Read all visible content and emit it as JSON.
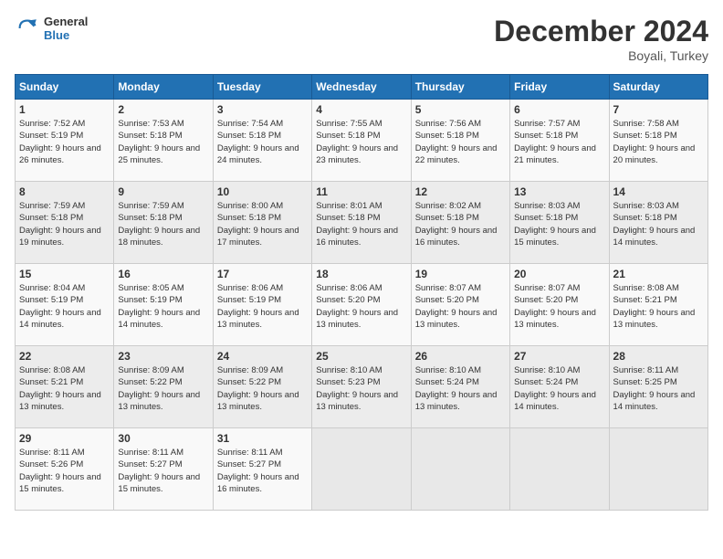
{
  "header": {
    "logo_general": "General",
    "logo_blue": "Blue",
    "title": "December 2024",
    "location": "Boyali, Turkey"
  },
  "days_of_week": [
    "Sunday",
    "Monday",
    "Tuesday",
    "Wednesday",
    "Thursday",
    "Friday",
    "Saturday"
  ],
  "weeks": [
    [
      {
        "day": "1",
        "sunrise": "7:52 AM",
        "sunset": "5:19 PM",
        "daylight": "9 hours and 26 minutes."
      },
      {
        "day": "2",
        "sunrise": "7:53 AM",
        "sunset": "5:18 PM",
        "daylight": "9 hours and 25 minutes."
      },
      {
        "day": "3",
        "sunrise": "7:54 AM",
        "sunset": "5:18 PM",
        "daylight": "9 hours and 24 minutes."
      },
      {
        "day": "4",
        "sunrise": "7:55 AM",
        "sunset": "5:18 PM",
        "daylight": "9 hours and 23 minutes."
      },
      {
        "day": "5",
        "sunrise": "7:56 AM",
        "sunset": "5:18 PM",
        "daylight": "9 hours and 22 minutes."
      },
      {
        "day": "6",
        "sunrise": "7:57 AM",
        "sunset": "5:18 PM",
        "daylight": "9 hours and 21 minutes."
      },
      {
        "day": "7",
        "sunrise": "7:58 AM",
        "sunset": "5:18 PM",
        "daylight": "9 hours and 20 minutes."
      }
    ],
    [
      {
        "day": "8",
        "sunrise": "7:59 AM",
        "sunset": "5:18 PM",
        "daylight": "9 hours and 19 minutes."
      },
      {
        "day": "9",
        "sunrise": "7:59 AM",
        "sunset": "5:18 PM",
        "daylight": "9 hours and 18 minutes."
      },
      {
        "day": "10",
        "sunrise": "8:00 AM",
        "sunset": "5:18 PM",
        "daylight": "9 hours and 17 minutes."
      },
      {
        "day": "11",
        "sunrise": "8:01 AM",
        "sunset": "5:18 PM",
        "daylight": "9 hours and 16 minutes."
      },
      {
        "day": "12",
        "sunrise": "8:02 AM",
        "sunset": "5:18 PM",
        "daylight": "9 hours and 16 minutes."
      },
      {
        "day": "13",
        "sunrise": "8:03 AM",
        "sunset": "5:18 PM",
        "daylight": "9 hours and 15 minutes."
      },
      {
        "day": "14",
        "sunrise": "8:03 AM",
        "sunset": "5:18 PM",
        "daylight": "9 hours and 14 minutes."
      }
    ],
    [
      {
        "day": "15",
        "sunrise": "8:04 AM",
        "sunset": "5:19 PM",
        "daylight": "9 hours and 14 minutes."
      },
      {
        "day": "16",
        "sunrise": "8:05 AM",
        "sunset": "5:19 PM",
        "daylight": "9 hours and 14 minutes."
      },
      {
        "day": "17",
        "sunrise": "8:06 AM",
        "sunset": "5:19 PM",
        "daylight": "9 hours and 13 minutes."
      },
      {
        "day": "18",
        "sunrise": "8:06 AM",
        "sunset": "5:20 PM",
        "daylight": "9 hours and 13 minutes."
      },
      {
        "day": "19",
        "sunrise": "8:07 AM",
        "sunset": "5:20 PM",
        "daylight": "9 hours and 13 minutes."
      },
      {
        "day": "20",
        "sunrise": "8:07 AM",
        "sunset": "5:20 PM",
        "daylight": "9 hours and 13 minutes."
      },
      {
        "day": "21",
        "sunrise": "8:08 AM",
        "sunset": "5:21 PM",
        "daylight": "9 hours and 13 minutes."
      }
    ],
    [
      {
        "day": "22",
        "sunrise": "8:08 AM",
        "sunset": "5:21 PM",
        "daylight": "9 hours and 13 minutes."
      },
      {
        "day": "23",
        "sunrise": "8:09 AM",
        "sunset": "5:22 PM",
        "daylight": "9 hours and 13 minutes."
      },
      {
        "day": "24",
        "sunrise": "8:09 AM",
        "sunset": "5:22 PM",
        "daylight": "9 hours and 13 minutes."
      },
      {
        "day": "25",
        "sunrise": "8:10 AM",
        "sunset": "5:23 PM",
        "daylight": "9 hours and 13 minutes."
      },
      {
        "day": "26",
        "sunrise": "8:10 AM",
        "sunset": "5:24 PM",
        "daylight": "9 hours and 13 minutes."
      },
      {
        "day": "27",
        "sunrise": "8:10 AM",
        "sunset": "5:24 PM",
        "daylight": "9 hours and 14 minutes."
      },
      {
        "day": "28",
        "sunrise": "8:11 AM",
        "sunset": "5:25 PM",
        "daylight": "9 hours and 14 minutes."
      }
    ],
    [
      {
        "day": "29",
        "sunrise": "8:11 AM",
        "sunset": "5:26 PM",
        "daylight": "9 hours and 15 minutes."
      },
      {
        "day": "30",
        "sunrise": "8:11 AM",
        "sunset": "5:27 PM",
        "daylight": "9 hours and 15 minutes."
      },
      {
        "day": "31",
        "sunrise": "8:11 AM",
        "sunset": "5:27 PM",
        "daylight": "9 hours and 16 minutes."
      },
      null,
      null,
      null,
      null
    ]
  ],
  "labels": {
    "sunrise": "Sunrise:",
    "sunset": "Sunset:",
    "daylight": "Daylight:"
  }
}
